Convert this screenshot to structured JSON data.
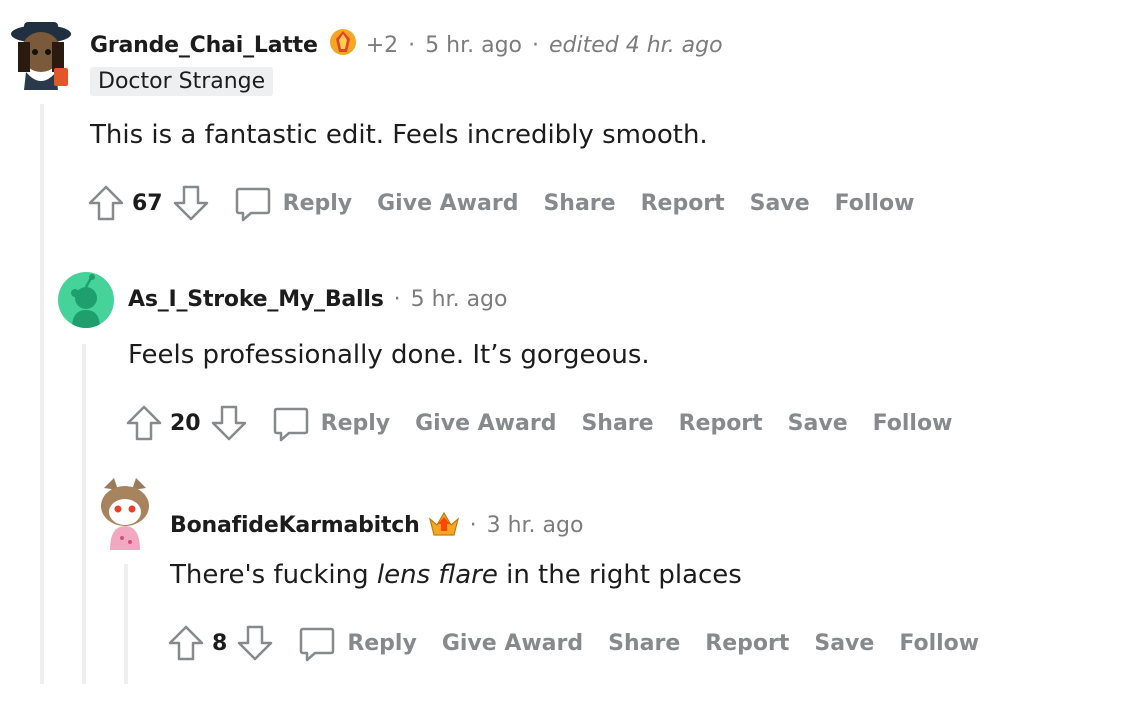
{
  "comments": [
    {
      "username": "Grande_Chai_Latte",
      "award_count": "+2",
      "time": "5 hr. ago",
      "edited": "edited 4 hr. ago",
      "flair": "Doctor Strange",
      "body": "This is a fantastic edit. Feels incredibly smooth.",
      "score": "67"
    },
    {
      "username": "As_I_Stroke_My_Balls",
      "time": "5 hr. ago",
      "body": "Feels professionally done. It’s gorgeous.",
      "score": "20"
    },
    {
      "username": "BonafideKarmabitch",
      "time": "3 hr. ago",
      "body_before": "There's fucking ",
      "body_em": "lens flare",
      "body_after": " in the right places",
      "score": "8"
    }
  ],
  "actions": {
    "reply": "Reply",
    "give_award": "Give Award",
    "share": "Share",
    "report": "Report",
    "save": "Save",
    "follow": "Follow"
  },
  "separator": "·",
  "colors": {
    "thread_line": "#edeff1",
    "action_text": "#878a8c",
    "meta_text": "#7c7c7c",
    "snoo_avatar_bg": "#46d39a"
  }
}
